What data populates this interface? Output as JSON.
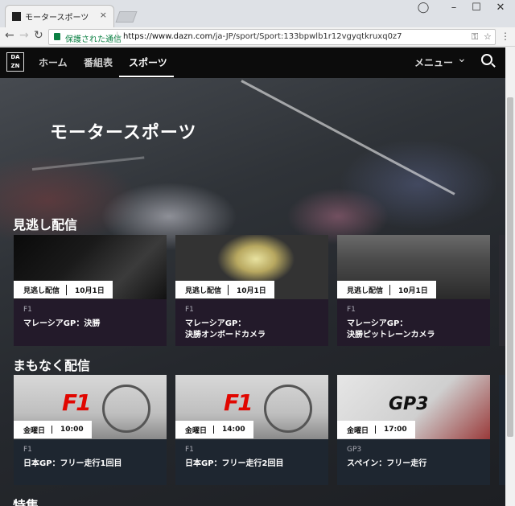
{
  "browser": {
    "tab_title": "モータースポーツ",
    "tab_close": "×",
    "secure_label": "保護された通信",
    "url_host": "https://www.dazn.com",
    "url_path": "/ja-JP/sport/Sport:133bpwlb1r12vgyqtkruxq0z7"
  },
  "nav": {
    "logo": "DA ZN",
    "links": [
      "ホーム",
      "番組表",
      "スポーツ"
    ],
    "menu_label": "メニュー"
  },
  "hero": {
    "title": "モータースポーツ"
  },
  "sections": [
    {
      "title": "見逃し配信",
      "cards": [
        {
          "badge_type": "見逃し配信",
          "badge_date": "10月1日",
          "sport": "F1",
          "title_line1": "マレーシアGP：決勝",
          "title_line2": ""
        },
        {
          "badge_type": "見逃し配信",
          "badge_date": "10月1日",
          "sport": "F1",
          "title_line1": "マレーシアGP：",
          "title_line2": "決勝オンボードカメラ"
        },
        {
          "badge_type": "見逃し配信",
          "badge_date": "10月1日",
          "sport": "F1",
          "title_line1": "マレーシアGP：",
          "title_line2": "決勝ピットレーンカメラ"
        }
      ]
    },
    {
      "title": "まもなく配信",
      "cards": [
        {
          "badge_type": "金曜日",
          "badge_date": "10:00",
          "sport": "F1",
          "title_line1": "日本GP：フリー走行1回目",
          "logo": "F1"
        },
        {
          "badge_type": "金曜日",
          "badge_date": "14:00",
          "sport": "F1",
          "title_line1": "日本GP：フリー走行2回目",
          "logo": "F1"
        },
        {
          "badge_type": "金曜日",
          "badge_date": "17:00",
          "sport": "GP3",
          "title_line1": "スペイン：フリー走行",
          "logo": "GP3"
        }
      ]
    },
    {
      "title": "特集"
    }
  ],
  "colors": {
    "nav_bg": "#0c0c0c",
    "card_bg": "#231a2a",
    "secure_green": "#0b8043"
  },
  "icons": [
    "back-icon",
    "forward-icon",
    "reload-icon",
    "lock-icon",
    "key-icon",
    "star-icon",
    "more-icon",
    "search-icon",
    "chevron-down-icon"
  ]
}
